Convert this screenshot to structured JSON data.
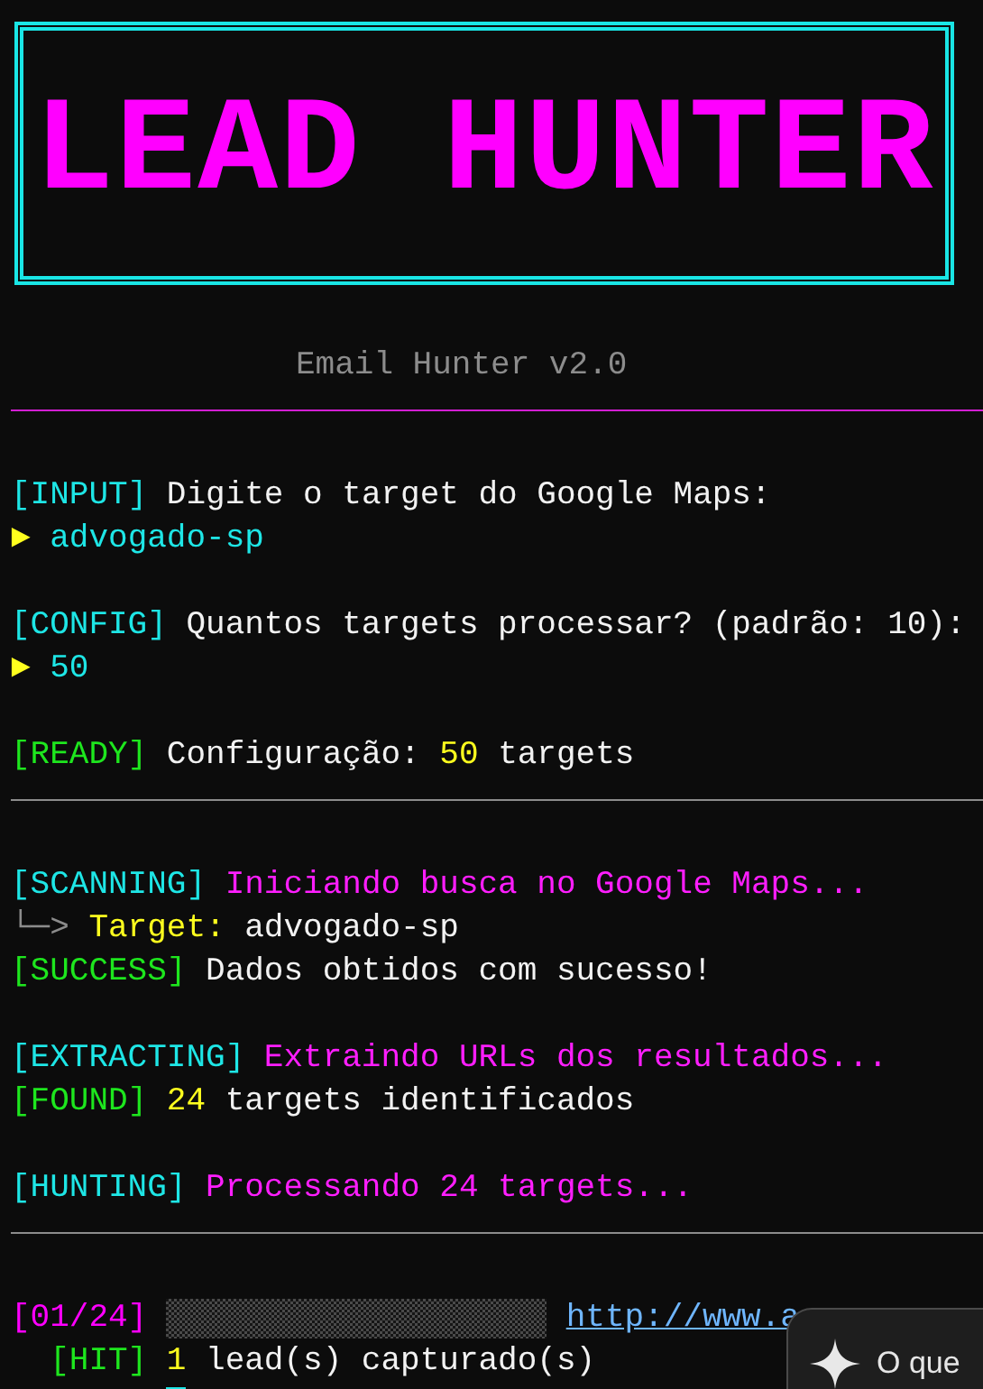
{
  "logo": "LEAD HUNTER",
  "subtitle": "Email Hunter v2.0",
  "lines": [
    {
      "kind": "rule",
      "color": "#d21ed2"
    },
    {
      "kind": "gap"
    },
    {
      "kind": "tagged",
      "tag": "[INPUT]",
      "color": "#1ee6e6",
      "parts": [
        {
          "color": "#f2f2f2",
          "text": "Digite o target do Google Maps:"
        }
      ]
    },
    {
      "kind": "prompt",
      "marker": "►",
      "value": "advogado-sp"
    },
    {
      "kind": "gap"
    },
    {
      "kind": "tagged",
      "tag": "[CONFIG]",
      "color": "#1ee6e6",
      "parts": [
        {
          "color": "#f2f2f2",
          "text": "Quantos targets processar? (padrão: 10):"
        }
      ]
    },
    {
      "kind": "prompt",
      "marker": "►",
      "value": "50"
    },
    {
      "kind": "gap"
    },
    {
      "kind": "tagged",
      "tag": "[READY]",
      "color": "#1ee61e",
      "parts": [
        {
          "color": "#f2f2f2",
          "text": "Configuração:"
        },
        {
          "color": "#ffff1e",
          "text": "50"
        },
        {
          "color": "#f2f2f2",
          "text": "targets"
        }
      ]
    },
    {
      "kind": "rule",
      "color": "#8c8c8c"
    },
    {
      "kind": "gap"
    },
    {
      "kind": "tagged",
      "tag": "[SCANNING]",
      "color": "#1ee6e6",
      "parts": [
        {
          "color": "#ff1eff",
          "text": "Iniciando busca no Google Maps..."
        }
      ]
    },
    {
      "kind": "tree",
      "parts": [
        {
          "color": "#8c8c8c",
          "text": "└─>"
        },
        {
          "color": "#ffff1e",
          "text": "Target:"
        },
        {
          "color": "#f2f2f2",
          "text": "advogado-sp"
        }
      ]
    },
    {
      "kind": "tagged",
      "tag": "[SUCCESS]",
      "color": "#1ee61e",
      "parts": [
        {
          "color": "#f2f2f2",
          "text": "Dados obtidos com sucesso!"
        }
      ]
    },
    {
      "kind": "gap"
    },
    {
      "kind": "tagged",
      "tag": "[EXTRACTING]",
      "color": "#1ee6e6",
      "parts": [
        {
          "color": "#ff1eff",
          "text": "Extraindo URLs dos resultados..."
        }
      ]
    },
    {
      "kind": "tagged",
      "tag": "[FOUND]",
      "color": "#1ee61e",
      "parts": [
        {
          "color": "#ffff1e",
          "text": "24"
        },
        {
          "color": "#f2f2f2",
          "text": "targets identificados"
        }
      ]
    },
    {
      "kind": "gap"
    },
    {
      "kind": "tagged",
      "tag": "[HUNTING]",
      "color": "#1ee6e6",
      "parts": [
        {
          "color": "#ff1eff",
          "text": "Processando 24 targets..."
        }
      ]
    },
    {
      "kind": "rule",
      "color": "#8c8c8c"
    },
    {
      "kind": "gap"
    },
    {
      "kind": "progress",
      "tag": "[01/24]",
      "level": 0,
      "url": "http://www.a"
    },
    {
      "kind": "sub",
      "tag": "[HIT]",
      "color": "#1ee61e",
      "parts": [
        {
          "color": "#ffff1e",
          "text": "1"
        },
        {
          "color": "#f2f2f2",
          "text": "lead(s) capturado(s)"
        }
      ]
    },
    {
      "kind": "cursor"
    }
  ],
  "popup": {
    "text": "O que"
  }
}
